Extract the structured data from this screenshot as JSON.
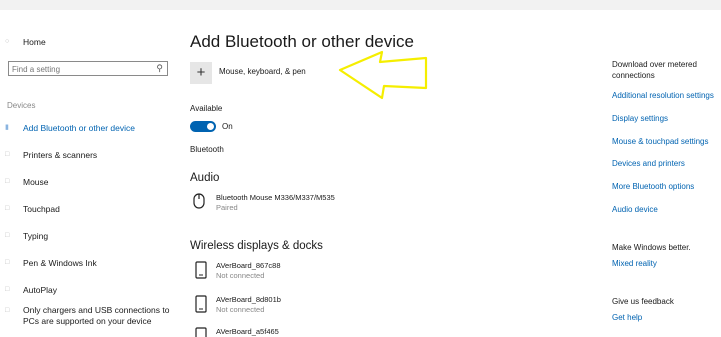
{
  "sidebar": {
    "home": "Home",
    "search_placeholder": "Find a setting",
    "section": "Devices",
    "items": [
      {
        "label": "Add Bluetooth or other device",
        "icon": "bluetooth-icon"
      },
      {
        "label": "Printers & scanners",
        "icon": "printer-icon"
      },
      {
        "label": "Mouse",
        "icon": "mouse-icon"
      },
      {
        "label": "Touchpad",
        "icon": "touchpad-icon"
      },
      {
        "label": "Typing",
        "icon": "keyboard-icon"
      },
      {
        "label": "Pen & Windows Ink",
        "icon": "pen-icon"
      },
      {
        "label": "AutoPlay",
        "icon": "autoplay-icon"
      },
      {
        "label": "Only chargers and USB connections to PCs are supported on your device",
        "icon": "usb-icon"
      }
    ]
  },
  "main": {
    "title": "Add Bluetooth or other device",
    "add_label": "Mouse, keyboard, & pen",
    "available_label": "Available",
    "toggle_state": "On",
    "bluetooth_label": "Bluetooth",
    "audio_heading": "Audio",
    "audio_devices": [
      {
        "name": "Bluetooth Mouse M336/M337/M535",
        "status": "Paired"
      }
    ],
    "wireless_heading": "Wireless displays & docks",
    "wireless_devices": [
      {
        "name": "AVerBoard_867c88",
        "status": "Not connected"
      },
      {
        "name": "AVerBoard_8d801b",
        "status": "Not connected"
      },
      {
        "name": "AVerBoard_a5f465",
        "status": ""
      }
    ]
  },
  "right": {
    "metered": "Download over metered connections",
    "links": [
      "Additional resolution settings",
      "Display settings",
      "Mouse & touchpad settings",
      "Devices and printers",
      "More Bluetooth options",
      "Audio device"
    ],
    "make_better": "Make Windows better.",
    "mixed_reality": "Mixed reality",
    "feedback": "Give us feedback",
    "get_help": "Get help"
  },
  "colors": {
    "accent": "#0063b1",
    "arrow": "#f5ee00"
  }
}
